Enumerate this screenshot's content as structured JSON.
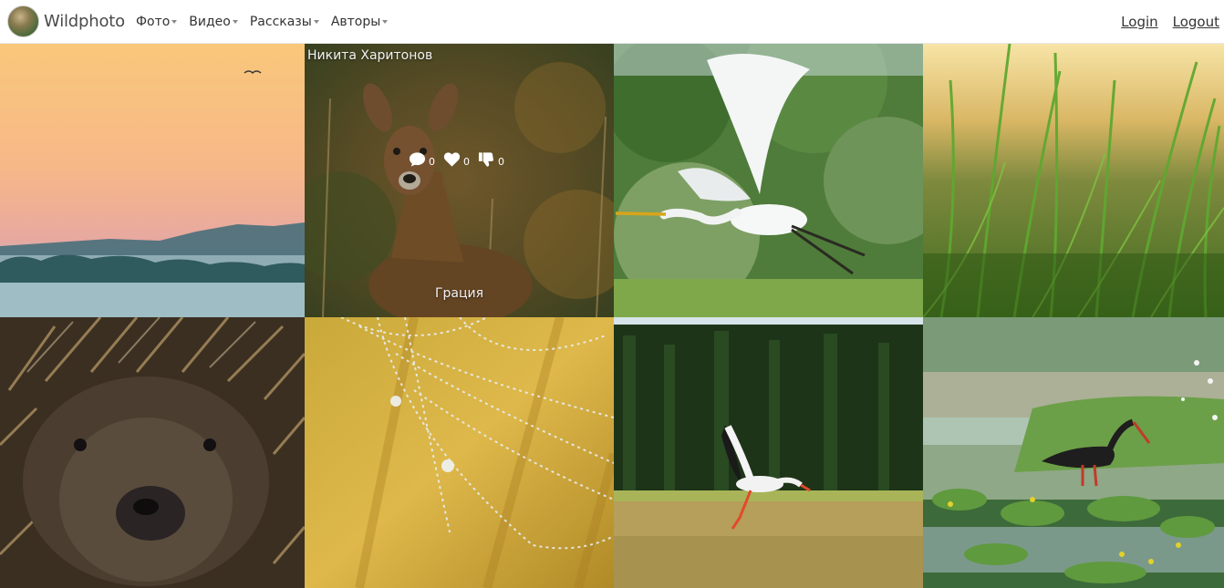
{
  "brand": {
    "name": "Wildphoto"
  },
  "menu": [
    {
      "label": "Фото"
    },
    {
      "label": "Видео"
    },
    {
      "label": "Рассказы"
    },
    {
      "label": "Авторы"
    }
  ],
  "auth": {
    "login": "Login",
    "logout": "Logout"
  },
  "hovered_photo": {
    "author": "Никита Харитонов",
    "title": "Грация",
    "comments": "0",
    "likes": "0",
    "dislikes": "0"
  },
  "icons": [
    "comment-icon",
    "heart-icon",
    "thumbs-down-icon",
    "chevron-down-icon"
  ]
}
